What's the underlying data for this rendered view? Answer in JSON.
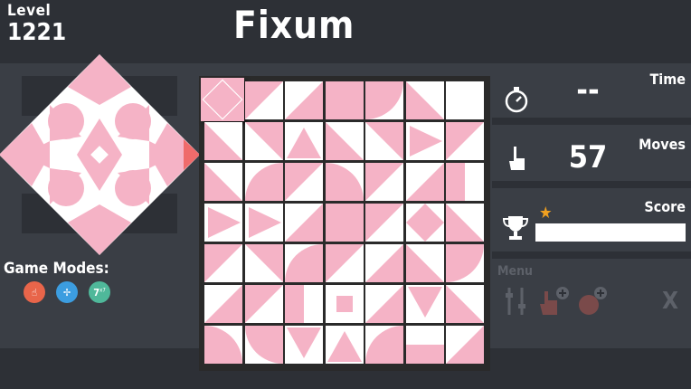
{
  "header": {
    "level_label": "Level",
    "level_number": "1221",
    "title": "Fixum"
  },
  "stats": {
    "time_label": "Time",
    "time_value": "--",
    "moves_label": "Moves",
    "moves_value": "57",
    "score_label": "Score",
    "score_fraction": 0
  },
  "game_modes": {
    "label": "Game Modes:",
    "modes": [
      {
        "icon": "hand-icon",
        "color": "#e8654a"
      },
      {
        "icon": "fan-icon",
        "color": "#3c9de0"
      },
      {
        "icon": "seven-icon",
        "label": "7",
        "sup": "x7",
        "color": "#4fb89a"
      }
    ]
  },
  "menu": {
    "label": "Menu",
    "close_label": "X"
  },
  "colors": {
    "tile_pink": "#f5b3c6",
    "tile_white": "#ffffff",
    "background": "#2d3036",
    "band": "#3a3e45"
  }
}
